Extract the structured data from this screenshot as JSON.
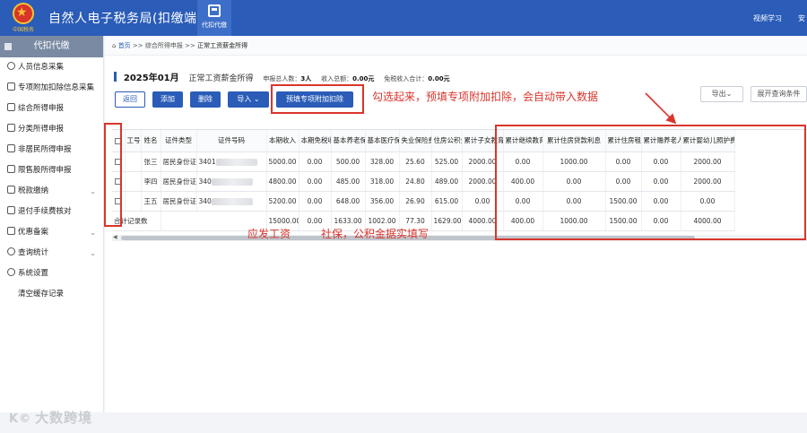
{
  "header": {
    "app_title": "自然人电子税务局(扣缴端)",
    "emblem_text": "中国税务",
    "nav_tile_label": "代扣代缴",
    "right_link": "视频学习",
    "right_cut": "安"
  },
  "sidebar": {
    "section_title": "代扣代缴",
    "items": [
      {
        "label": "人员信息采集",
        "icon": "person-icon",
        "chevron": ""
      },
      {
        "label": "专项附加扣除信息采集",
        "icon": "document-icon",
        "chevron": ""
      },
      {
        "label": "综合所得申报",
        "icon": "report-icon",
        "chevron": ""
      },
      {
        "label": "分类所得申报",
        "icon": "category-icon",
        "chevron": ""
      },
      {
        "label": "非居民所得申报",
        "icon": "nonresident-icon",
        "chevron": ""
      },
      {
        "label": "限售股所得申报",
        "icon": "stock-icon",
        "chevron": ""
      },
      {
        "label": "税款缴纳",
        "icon": "payment-icon",
        "chevron": "⌄"
      },
      {
        "label": "退付手续费核对",
        "icon": "refund-icon",
        "chevron": ""
      },
      {
        "label": "优惠备案",
        "icon": "discount-icon",
        "chevron": "⌄"
      },
      {
        "label": "查询统计",
        "icon": "query-icon",
        "chevron": "⌄"
      },
      {
        "label": "系统设置",
        "icon": "settings-icon",
        "chevron": ""
      },
      {
        "label": "清空缓存记录",
        "icon": "",
        "chevron": ""
      }
    ]
  },
  "breadcrumb": {
    "home": "首页",
    "sep": ">>",
    "level1": "综合所得申报",
    "level2": "正常工资薪金所得"
  },
  "info": {
    "period": "2025年01月",
    "item_name": "正常工资薪金所得",
    "people_label": "申报总人数：",
    "people_value": "3人",
    "income_label": "收入总额：",
    "income_value": "0.00元",
    "exempt_label": "免税收入合计：",
    "exempt_value": "0.00元"
  },
  "toolbar": {
    "back": "返回",
    "add": "添加",
    "delete": "删除",
    "import": "导入",
    "prefill": "预填专项附加扣除",
    "export": "导出",
    "expand_query": "展开查询条件"
  },
  "table": {
    "headers": [
      "",
      "工号",
      "姓名",
      "证件类型",
      "证件号码",
      "本期收入",
      "本期免税收入",
      "基本养老保险",
      "基本医疗保险",
      "失业保险费",
      "住房公积金",
      "累计子女教育",
      "累计继续教育",
      "累计住房贷款利息",
      "累计住房租金",
      "累计赡养老人",
      "累计婴幼儿照护费用"
    ],
    "rows": [
      {
        "cells": [
          "",
          "",
          "张三",
          "居民身份证",
          "3401",
          "5000.00",
          "0.00",
          "500.00",
          "328.00",
          "25.60",
          "525.00",
          "2000.00",
          "0.00",
          "1000.00",
          "0.00",
          "0.00",
          "2000.00"
        ]
      },
      {
        "cells": [
          "",
          "",
          "李四",
          "居民身份证",
          "340",
          "4800.00",
          "0.00",
          "485.00",
          "318.00",
          "24.80",
          "489.00",
          "2000.00",
          "400.00",
          "0.00",
          "0.00",
          "0.00",
          "2000.00"
        ]
      },
      {
        "cells": [
          "",
          "",
          "王五",
          "居民身份证",
          "340",
          "5200.00",
          "0.00",
          "648.00",
          "356.00",
          "26.90",
          "615.00",
          "0.00",
          "0.00",
          "0.00",
          "1500.00",
          "0.00",
          "0.00"
        ]
      }
    ],
    "total_label": "合计记录数",
    "totals": [
      "15000.00",
      "0.00",
      "1633.00",
      "1002.00",
      "77.30",
      "1629.00",
      "4000.00",
      "400.00",
      "1000.00",
      "1500.00",
      "0.00",
      "4000.00"
    ]
  },
  "annotations": {
    "select_tip": "勾选起来，预填专项附加扣除，会自动带入数据",
    "wage_tip": "应发工资",
    "insurance_tip": "社保，公积金据实填写",
    "color": "#d9352c"
  },
  "watermark": {
    "mark": "K©",
    "text": "大数跨境"
  }
}
